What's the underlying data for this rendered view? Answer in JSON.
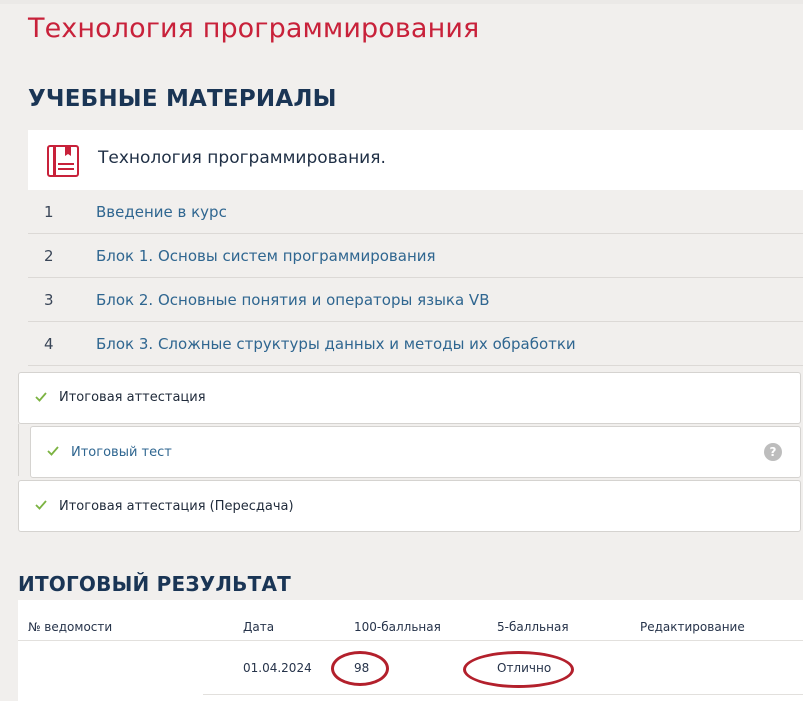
{
  "page_title": "Технология программирования",
  "materials": {
    "heading": "УЧЕБНЫЕ МАТЕРИАЛЫ",
    "course_name": "Технология программирования.",
    "modules": [
      {
        "num": "1",
        "label": "Введение в курс"
      },
      {
        "num": "2",
        "label": "Блок 1. Основы систем программирования"
      },
      {
        "num": "3",
        "label": "Блок 2. Основные понятия и операторы языка VB"
      },
      {
        "num": "4",
        "label": "Блок 3. Сложные структуры данных и методы их обработки"
      }
    ]
  },
  "attestation": {
    "final": "Итоговая аттестация",
    "test": "Итоговый тест",
    "retake": "Итоговая аттестация (Пересдача)",
    "help_glyph": "?"
  },
  "result": {
    "heading": "ИТОГОВЫЙ РЕЗУЛЬТАТ",
    "columns": [
      "№ ведомости",
      "Дата",
      "100-балльная",
      "5-балльная",
      "Редактирование"
    ],
    "row": {
      "sheet_no": "",
      "date": "01.04.2024",
      "score100": "98",
      "score5": "Отлично",
      "edit": ""
    }
  },
  "colors": {
    "title_red": "#c8213a",
    "heading_navy": "#1a3555",
    "link_blue": "#2f6690",
    "check_green": "#7cb342",
    "annotation_red": "#b3202c"
  }
}
